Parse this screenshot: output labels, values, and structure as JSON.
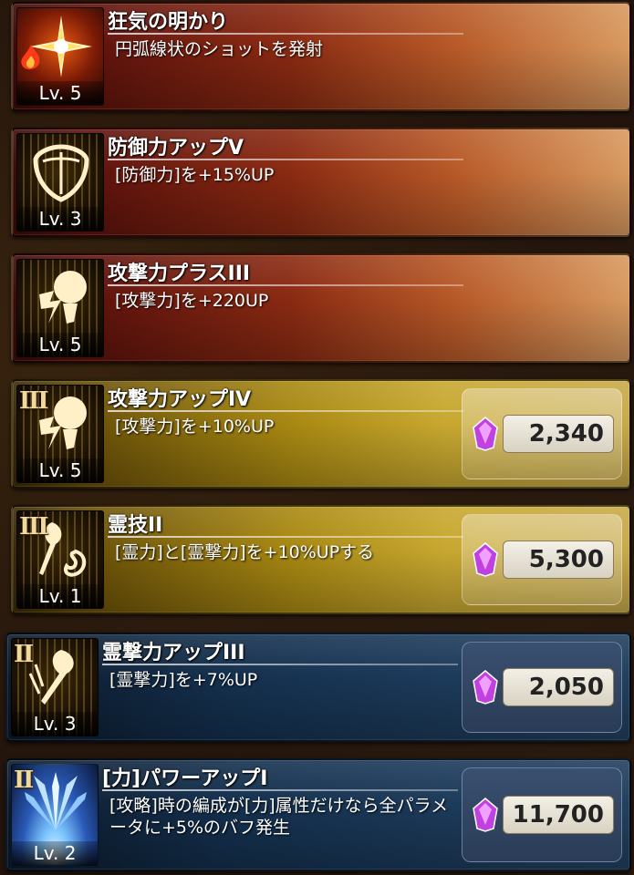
{
  "skills": [
    {
      "name": "狂気の明かり",
      "desc": "円弧線状のショットを発射",
      "level": "Lv. 5",
      "rank": "",
      "cost": "",
      "theme": "red",
      "icon": "fire-burst-icon"
    },
    {
      "name": "防御力アップV",
      "desc": "[防御力]を+15%UP",
      "level": "Lv. 3",
      "rank": "",
      "cost": "",
      "theme": "red",
      "icon": "shield-icon"
    },
    {
      "name": "攻撃力プラスIII",
      "desc": "[攻撃力]を+220UP",
      "level": "Lv. 5",
      "rank": "",
      "cost": "",
      "theme": "red",
      "icon": "fist-icon"
    },
    {
      "name": "攻撃力アップIV",
      "desc": "[攻撃力]を+10%UP",
      "level": "Lv. 5",
      "rank": "III",
      "cost": "2,340",
      "theme": "gold",
      "icon": "fist-icon"
    },
    {
      "name": "霊技II",
      "desc": "[霊力]と[霊撃力]を+10%UPする",
      "level": "Lv. 1",
      "rank": "III",
      "cost": "5,300",
      "theme": "gold",
      "icon": "spirit-flame-icon"
    },
    {
      "name": "霊撃力アップIII",
      "desc": "[霊撃力]を+7%UP",
      "level": "Lv. 3",
      "rank": "II",
      "cost": "2,050",
      "theme": "blue",
      "icon": "spirit-flame-icon"
    },
    {
      "name": "[力]パワーアップI",
      "desc": "[攻略]時の編成が[力]属性だけなら全パラメータに+5%のバフ発生",
      "level": "Lv. 2",
      "rank": "II",
      "cost": "11,700",
      "theme": "blue",
      "icon": "power-burst-icon"
    }
  ],
  "colors": {
    "gem": "#c040e0",
    "red_theme": "#8a2a12",
    "gold_theme": "#a88812",
    "blue_theme": "#1c3a5a"
  }
}
